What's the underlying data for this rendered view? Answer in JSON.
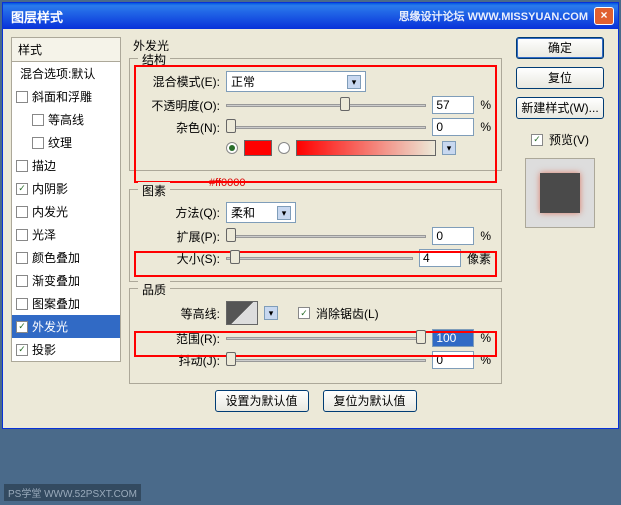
{
  "titlebar": {
    "title": "图层样式",
    "watermark": "思缘设计论坛  WWW.MISSYUAN.COM",
    "close": "×"
  },
  "styles": {
    "header": "样式",
    "blend": "混合选项:默认",
    "items": [
      {
        "label": "斜面和浮雕",
        "checked": false,
        "sub": false
      },
      {
        "label": "等高线",
        "checked": false,
        "sub": true
      },
      {
        "label": "纹理",
        "checked": false,
        "sub": true
      },
      {
        "label": "描边",
        "checked": false,
        "sub": false
      },
      {
        "label": "内阴影",
        "checked": true,
        "sub": false
      },
      {
        "label": "内发光",
        "checked": false,
        "sub": false
      },
      {
        "label": "光泽",
        "checked": false,
        "sub": false
      },
      {
        "label": "颜色叠加",
        "checked": false,
        "sub": false
      },
      {
        "label": "渐变叠加",
        "checked": false,
        "sub": false
      },
      {
        "label": "图案叠加",
        "checked": false,
        "sub": false
      },
      {
        "label": "外发光",
        "checked": true,
        "sub": false,
        "selected": true
      },
      {
        "label": "投影",
        "checked": true,
        "sub": false
      }
    ]
  },
  "main": {
    "header": "外发光",
    "structure": {
      "legend": "结构",
      "blend_mode_label": "混合模式(E):",
      "blend_mode_value": "正常",
      "opacity_label": "不透明度(O):",
      "opacity_value": "57",
      "opacity_unit": "%",
      "noise_label": "杂色(N):",
      "noise_value": "0",
      "noise_unit": "%",
      "hex": "#ff0000"
    },
    "elements": {
      "legend": "图素",
      "technique_label": "方法(Q):",
      "technique_value": "柔和",
      "spread_label": "扩展(P):",
      "spread_value": "0",
      "spread_unit": "%",
      "size_label": "大小(S):",
      "size_value": "4",
      "size_unit": "像素"
    },
    "quality": {
      "legend": "品质",
      "contour_label": "等高线:",
      "antialias_label": "消除锯齿(L)",
      "range_label": "范围(R):",
      "range_value": "100",
      "range_unit": "%",
      "jitter_label": "抖动(J):",
      "jitter_value": "0",
      "jitter_unit": "%"
    },
    "defaults": {
      "set": "设置为默认值",
      "reset": "复位为默认值"
    }
  },
  "buttons": {
    "ok": "确定",
    "cancel": "复位",
    "new_style": "新建样式(W)...",
    "preview": "预览(V)"
  },
  "watermark_bl": "PS学堂  WWW.52PSXT.COM"
}
